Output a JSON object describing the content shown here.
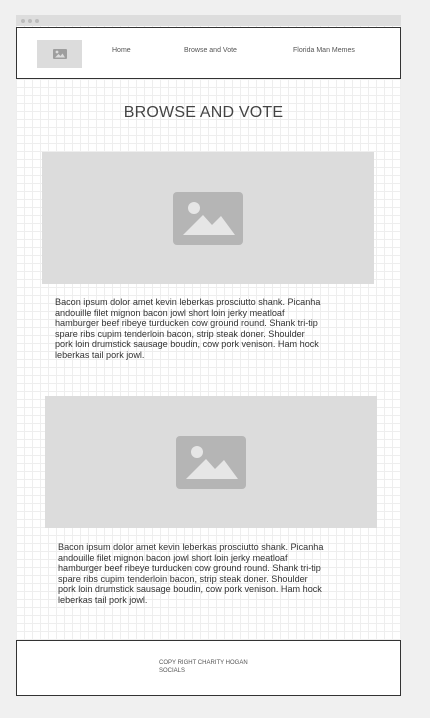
{
  "nav": {
    "logo_icon": "image-placeholder-icon",
    "links": [
      "Home",
      "Browse and Vote",
      "Florida Man Memes"
    ]
  },
  "main": {
    "title": "BROWSE AND VOTE",
    "cards": [
      {
        "image_icon": "image-placeholder-icon",
        "text": "Bacon ipsum dolor amet kevin leberkas prosciutto shank. Picanha\nandouille filet mignon bacon jowl short loin jerky meatloaf\nhamburger beef ribeye turducken cow ground round. Shank tri-tip\nspare ribs cupim tenderloin bacon, strip steak doner. Shoulder\npork loin drumstick sausage boudin, cow pork venison. Ham hock\nleberkas tail pork jowl."
      },
      {
        "image_icon": "image-placeholder-icon",
        "text": "Bacon ipsum dolor amet kevin leberkas prosciutto shank. Picanha\nandouille filet mignon bacon jowl short loin jerky meatloaf\nhamburger beef ribeye turducken cow ground round. Shank tri-tip\nspare ribs cupim tenderloin bacon, strip steak doner. Shoulder\npork loin drumstick sausage boudin, cow pork venison. Ham hock\nleberkas tail pork jowl."
      }
    ]
  },
  "footer": {
    "copyright": "COPY RIGHT CHARITY HOGAN",
    "socials": "SOCIALS"
  },
  "colors": {
    "placeholder_bg": "#dcdcdc",
    "placeholder_icon": "#b5b5b5",
    "border": "#333333"
  }
}
